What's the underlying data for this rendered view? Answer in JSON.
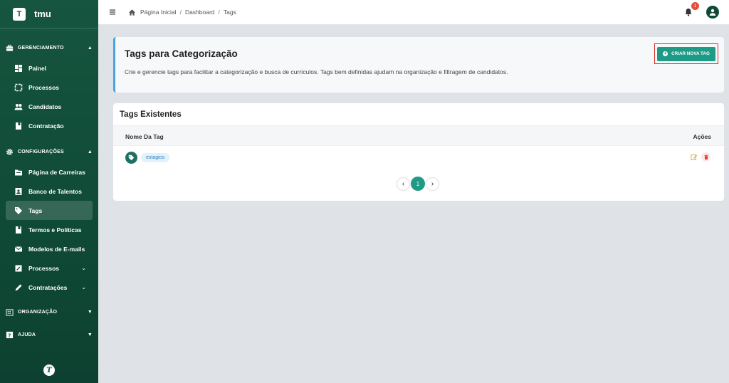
{
  "brand": {
    "logo_letter": "T",
    "name": "tmu"
  },
  "sidebar": {
    "sections": [
      {
        "label": "GERENCIAMENTO",
        "icon": "briefcase-icon"
      },
      {
        "label": "CONFIGURAÇÕES",
        "icon": "gear-icon"
      },
      {
        "label": "ORGANIZAÇÃO",
        "icon": "building-icon"
      },
      {
        "label": "AJUDA",
        "icon": "help-icon"
      }
    ],
    "items": [
      {
        "label": "Painel",
        "icon": "dashboard-icon"
      },
      {
        "label": "Processos",
        "icon": "process-icon"
      },
      {
        "label": "Candidatos",
        "icon": "people-icon"
      },
      {
        "label": "Contratação",
        "icon": "document-icon"
      },
      {
        "label": "Página de Carreiras",
        "icon": "folder-icon"
      },
      {
        "label": "Banco de Talentos",
        "icon": "contact-card-icon"
      },
      {
        "label": "Tags",
        "icon": "tag-icon"
      },
      {
        "label": "Termos e Políticas",
        "icon": "document-icon"
      },
      {
        "label": "Modelos de E-mails",
        "icon": "mail-icon"
      },
      {
        "label": "Processos",
        "icon": "edit-box-icon"
      },
      {
        "label": "Contratações",
        "icon": "pencil-icon"
      }
    ],
    "footer_logo": "T"
  },
  "topbar": {
    "breadcrumb": [
      "Página Inicial",
      "Dashboard",
      "Tags"
    ],
    "notification_count": "1"
  },
  "hero": {
    "title": "Tags para Categorização",
    "description": "Crie e gerencie tags para facilitar a categorização e busca de currículos. Tags bem definidas ajudam na organização e filtragem de candidatos.",
    "button_label": "CRIAR NOVA TAG"
  },
  "table": {
    "title": "Tags Existentes",
    "columns": [
      "Nome Da Tag",
      "Ações"
    ],
    "rows": [
      {
        "tag": "estagios"
      }
    ],
    "current_page": "1"
  },
  "colors": {
    "sidebar": "#15553f",
    "primary": "#1f9a86",
    "accent_border": "#4aa3df",
    "highlight": "#d9302c"
  }
}
